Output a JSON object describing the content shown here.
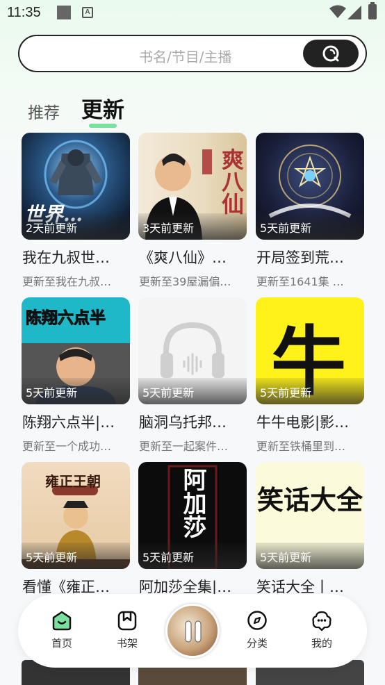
{
  "status_bar": {
    "time": "11:35",
    "app_badge": "A"
  },
  "search": {
    "placeholder": "书名/节目/主播",
    "icon": "search-icon"
  },
  "tabs": [
    {
      "label": "推荐",
      "active": false
    },
    {
      "label": "更新",
      "active": true
    }
  ],
  "accent_color": "#7be0a0",
  "items": [
    {
      "updated": "2天前更新",
      "title": "我在九叔世…",
      "subtitle": "更新至我在九叔…",
      "cover_text": "世界…"
    },
    {
      "updated": "3天前更新",
      "title": "《爽八仙》…",
      "subtitle": "更新至39屋漏偏…",
      "cover_text": "爽八仙"
    },
    {
      "updated": "5天前更新",
      "title": "开局签到荒…",
      "subtitle": "更新至1641集 …",
      "cover_text": ""
    },
    {
      "updated": "5天前更新",
      "title": "陈翔六点半|…",
      "subtitle": "更新至一个成功…",
      "cover_text": "陈翔六点半"
    },
    {
      "updated": "5天前更新",
      "title": "脑洞乌托邦…",
      "subtitle": "更新至一起案件…",
      "cover_text": ""
    },
    {
      "updated": "5天前更新",
      "title": "牛牛电影|影…",
      "subtitle": "更新至铁桶里到…",
      "cover_text": "牛"
    },
    {
      "updated": "5天前更新",
      "title": "看懂《雍正…",
      "subtitle": "",
      "cover_text": "雍正王朝"
    },
    {
      "updated": "5天前更新",
      "title": "阿加莎全集|…",
      "subtitle": "",
      "cover_text": "阿加莎"
    },
    {
      "updated": "5天前更新",
      "title": "笑话大全丨…",
      "subtitle": "",
      "cover_text": "笑话大全"
    }
  ],
  "bottom_nav": [
    {
      "label": "首页",
      "icon": "home-icon",
      "active": true
    },
    {
      "label": "书架",
      "icon": "bookshelf-icon",
      "active": false
    },
    {
      "label": "分类",
      "icon": "category-icon",
      "active": false
    },
    {
      "label": "我的",
      "icon": "profile-icon",
      "active": false
    }
  ],
  "player": {
    "state": "playing",
    "icon": "pause-icon"
  }
}
